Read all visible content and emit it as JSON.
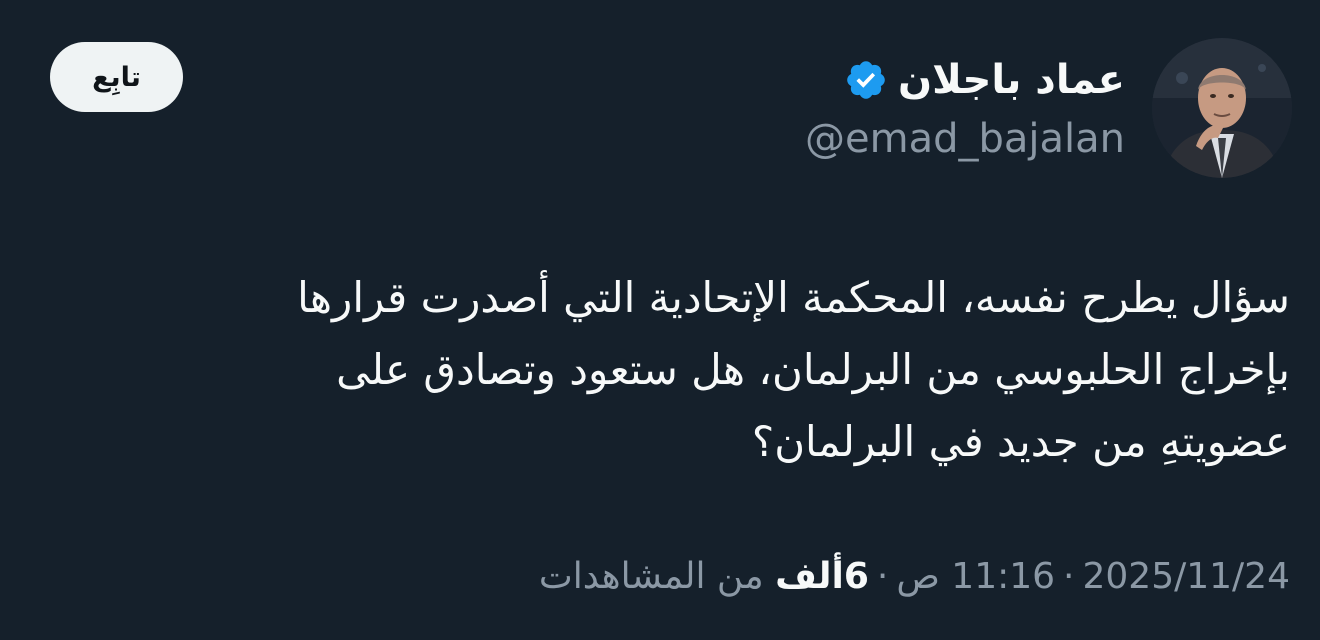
{
  "author": {
    "display_name": "عماد باجلان",
    "handle": "@emad_bajalan",
    "verified": true,
    "avatar_icon": "profile-photo"
  },
  "follow_button": {
    "label": "تابِع"
  },
  "tweet": {
    "text": "سؤال يطرح نفسه، المحكمة الإتحادية التي أصدرت قرارها\nبإخراج الحلبوسي من البرلمان، هل ستعود وتصادق على\nعضويتهِ من جديد في البرلمان؟"
  },
  "meta": {
    "date": "2025/11/24",
    "time": "11:16 ص",
    "views_count": "6ألف",
    "views_label": "من المشاهدات",
    "separator": "·"
  },
  "colors": {
    "background": "#15202b",
    "text_primary": "#f7f9f9",
    "text_secondary": "#8b98a5",
    "verified_badge": "#1d9bf0",
    "button_bg": "#eff3f4"
  }
}
